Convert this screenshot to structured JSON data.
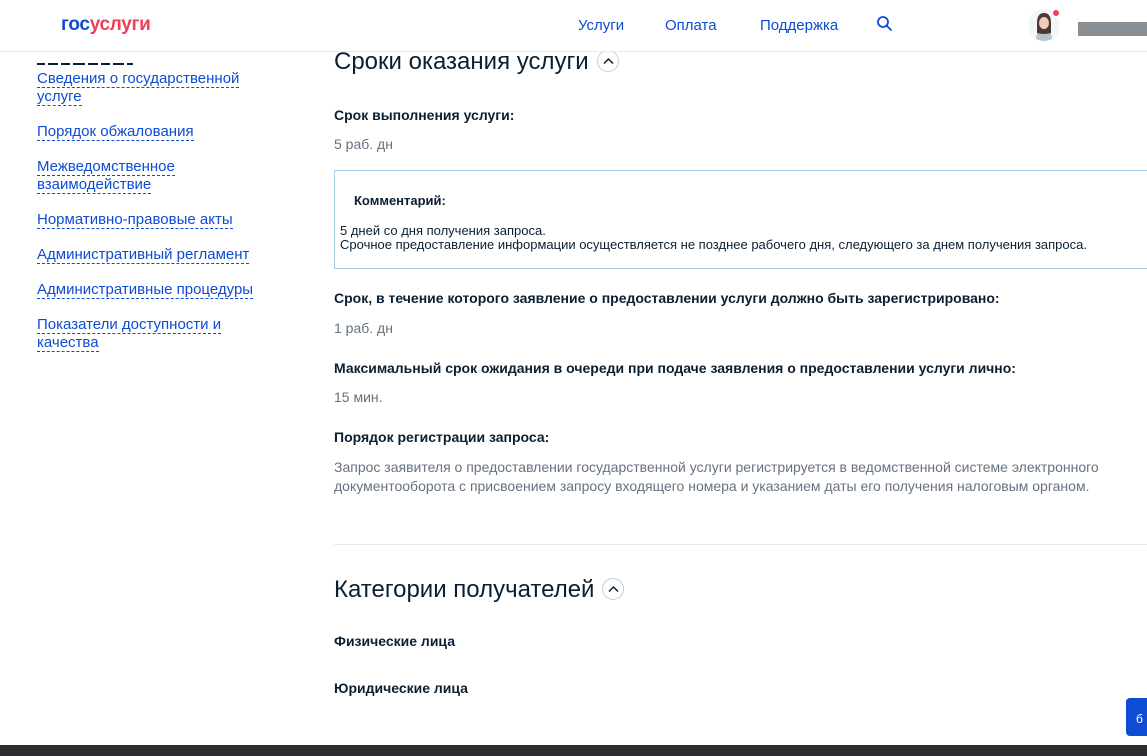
{
  "header": {
    "logo_gos": "гос",
    "logo_uslugi": "услуги",
    "nav": [
      "Услуги",
      "Оплата",
      "Поддержка"
    ]
  },
  "sidebar": {
    "items": [
      {
        "label": "Сведения о государственной услуге"
      },
      {
        "label": "Порядок обжалования"
      },
      {
        "label": "Межведомственное взаимодействие"
      },
      {
        "label": "Нормативно-правовые акты"
      },
      {
        "label": "Административный регламент"
      },
      {
        "label": "Административные процедуры"
      },
      {
        "label": "Показатели доступности и качества"
      }
    ]
  },
  "main": {
    "terms": {
      "title": "Сроки оказания услуги",
      "execution_label": "Срок выполнения услуги:",
      "execution_value": "5 раб. дн",
      "comment_title": "Комментарий:",
      "comment_line1": "5 дней со дня получения запроса.",
      "comment_line2": "Срочное предоставление информации осуществляется не позднее рабочего дня, следующего за днем получения запроса.",
      "registration_label": "Срок, в течение которого заявление о предоставлении услуги должно быть зарегистрировано:",
      "registration_value": "1 раб. дн",
      "queue_label": "Максимальный срок ожидания в очереди при подаче заявления о предоставлении услуги лично:",
      "queue_value": "15 мин.",
      "order_label": "Порядок регистрации запроса:",
      "order_text": "Запрос заявителя о предоставлении государственной услуги регистрируется в ведомственной системе электронного документооборота с присвоением запросу входящего номера и указанием даты его получения налоговым органом."
    },
    "recipients": {
      "title": "Категории получателей",
      "items": [
        "Физические лица",
        "Юридические лица"
      ]
    }
  },
  "help_button_char": "б",
  "colors": {
    "brand_blue": "#0d4cd3",
    "brand_red": "#ee3f58",
    "comment_border": "#a3cce8"
  }
}
